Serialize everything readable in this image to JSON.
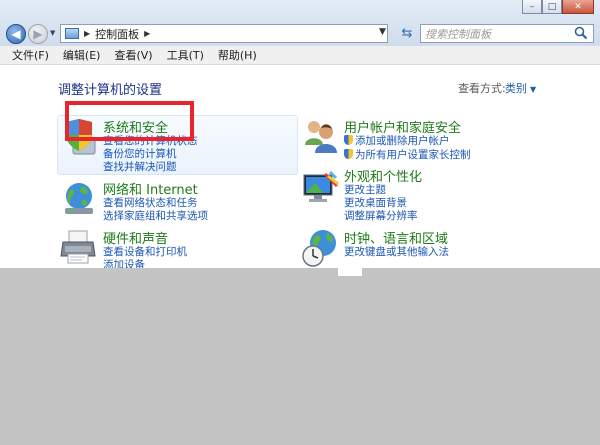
{
  "address": {
    "breadcrumb": "控制面板"
  },
  "search": {
    "placeholder": "搜索控制面板"
  },
  "menu": [
    "文件(F)",
    "编辑(E)",
    "查看(V)",
    "工具(T)",
    "帮助(H)"
  ],
  "page_title": "调整计算机的设置",
  "view_by": {
    "label": "查看方式:",
    "value": "类别"
  },
  "categories": [
    {
      "title": "系统和安全",
      "links": [
        "查看您的计算机状态",
        "备份您的计算机",
        "查找并解决问题"
      ],
      "icon": "shield-icon"
    },
    {
      "title": "网络和 Internet",
      "links": [
        "查看网络状态和任务",
        "选择家庭组和共享选项"
      ],
      "icon": "network-icon"
    },
    {
      "title": "硬件和声音",
      "links": [
        "查看设备和打印机",
        "添加设备"
      ],
      "icon": "printer-icon"
    },
    {
      "title": "用户帐户和家庭安全",
      "links": [
        "添加或删除用户帐户",
        "为所有用户设置家长控制"
      ],
      "icon": "users-icon"
    },
    {
      "title": "外观和个性化",
      "links": [
        "更改主题",
        "更改桌面背景",
        "调整屏幕分辨率"
      ],
      "icon": "appearance-icon"
    },
    {
      "title": "时钟、语言和区域",
      "links": [
        "更改键盘或其他输入法"
      ],
      "icon": "clock-globe-icon"
    }
  ],
  "colors": {
    "highlight": "#e8252c",
    "category_title": "#1e7a18",
    "link": "#1a56b5",
    "background": "#c4c4c4"
  }
}
